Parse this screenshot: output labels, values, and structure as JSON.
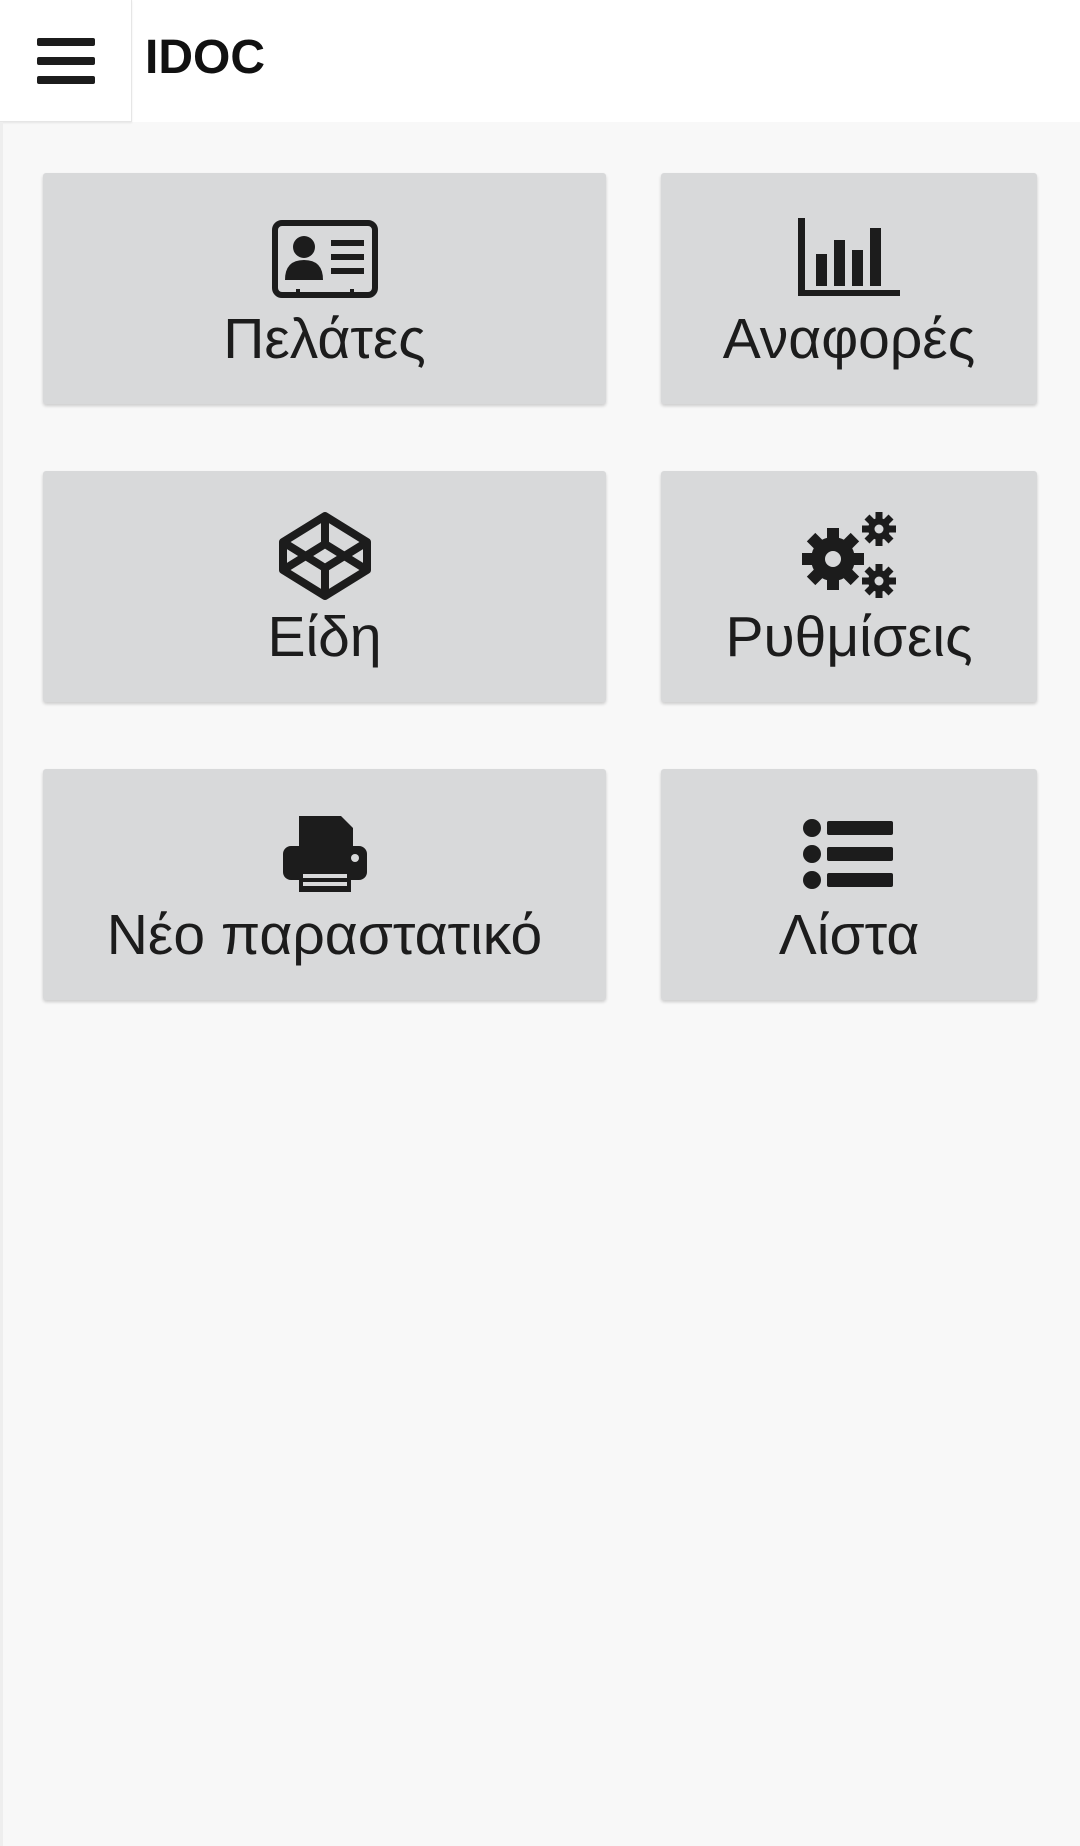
{
  "header": {
    "title": "IDOC",
    "menu_icon": "hamburger-menu-icon"
  },
  "tiles": [
    {
      "label": "Πελάτες",
      "icon": "contact-card-icon"
    },
    {
      "label": "Αναφορές",
      "icon": "bar-chart-icon"
    },
    {
      "label": "Είδη",
      "icon": "codepen-box-icon"
    },
    {
      "label": "Ρυθμίσεις",
      "icon": "gears-icon"
    },
    {
      "label": "Νέο παραστατικό",
      "icon": "printer-icon"
    },
    {
      "label": "Λίστα",
      "icon": "list-icon"
    }
  ],
  "colors": {
    "tile_background": "#d8d9da",
    "icon": "#1c1c1c",
    "page_background": "#f8f8f8"
  }
}
